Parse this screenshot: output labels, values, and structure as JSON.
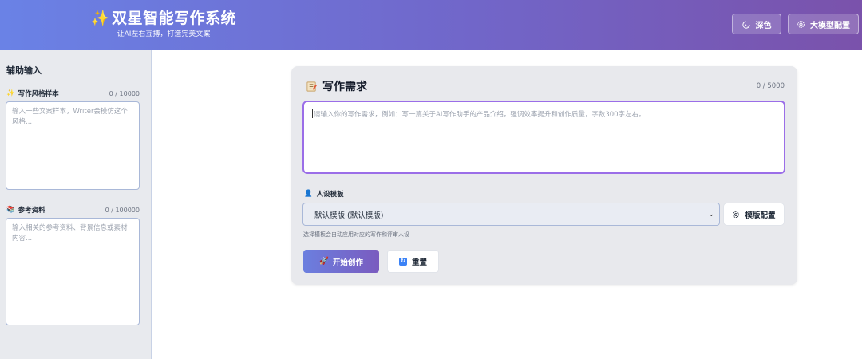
{
  "app": {
    "title": "双星智能写作系统",
    "subtitle": "让AI左右互搏，打造完美文案",
    "accent": "#7166c9"
  },
  "header": {
    "theme_button": "深色",
    "model_config_button": "大模型配置"
  },
  "sidebar": {
    "title": "辅助输入",
    "style_sample": {
      "label": "写作风格样本",
      "counter": "0 / 10000",
      "placeholder": "输入一些文案样本，Writer会模仿这个风格..."
    },
    "reference": {
      "label": "参考资料",
      "counter": "0 / 100000",
      "placeholder": "输入相关的参考资料、背景信息或素材内容..."
    }
  },
  "main": {
    "title": "写作需求",
    "counter": "0 / 5000",
    "requirement_placeholder": "请输入你的写作需求，例如：写一篇关于AI写作助手的产品介绍，强调效率提升和创作质量，字数300字左右。",
    "persona_label": "人设模板",
    "persona_selected": "默认模版 (默认模版)",
    "template_config_button": "模版配置",
    "hint": "选择模板会自动应用对应的写作和评审人设",
    "start_button": "开始创作",
    "reset_button": "重置"
  }
}
